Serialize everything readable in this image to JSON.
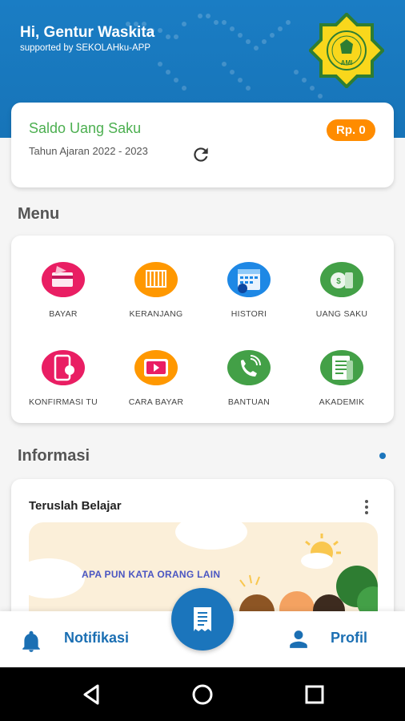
{
  "header": {
    "greeting": "Hi, Gentur Waskita",
    "support": "supported by SEKOLAHku-APP",
    "logo_text": "AMI"
  },
  "saldo": {
    "title": "Saldo Uang Saku",
    "year": "Tahun Ajaran 2022 - 2023",
    "amount": "Rp. 0"
  },
  "menu": {
    "title": "Menu",
    "items": [
      {
        "label": "BAYAR",
        "icon": "payment-icon",
        "color": "#e91e63"
      },
      {
        "label": "KERANJANG",
        "icon": "cart-icon",
        "color": "#ff9800"
      },
      {
        "label": "HISTORI",
        "icon": "calendar-history-icon",
        "color": "#1e88e5"
      },
      {
        "label": "UANG SAKU",
        "icon": "money-bag-icon",
        "color": "#43a047"
      },
      {
        "label": "KONFIRMASI TU",
        "icon": "phone-confirm-icon",
        "color": "#e91e63"
      },
      {
        "label": "CARA BAYAR",
        "icon": "video-play-icon",
        "color": "#ff9800"
      },
      {
        "label": "BANTUAN",
        "icon": "phone-call-icon",
        "color": "#43a047"
      },
      {
        "label": "AKADEMIK",
        "icon": "document-icon",
        "color": "#43a047"
      }
    ]
  },
  "informasi": {
    "title": "Informasi",
    "card_title": "Teruslah Belajar",
    "banner_text": "APA PUN KATA ORANG LAIN"
  },
  "nav": {
    "notifikasi": "Notifikasi",
    "profil": "Profil"
  },
  "colors": {
    "primary": "#1b75bc",
    "accent": "#ff8c00",
    "saldo_green": "#4caf50"
  }
}
